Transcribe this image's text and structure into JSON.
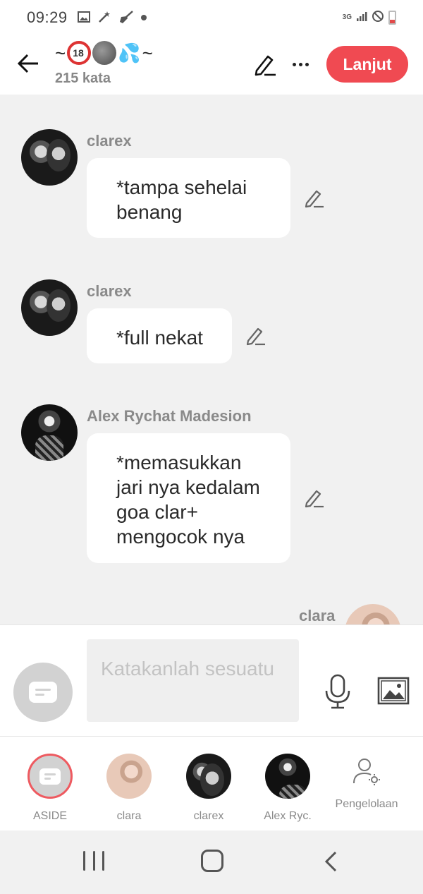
{
  "status_bar": {
    "time": "09:29",
    "network": "3G",
    "icons": [
      "gallery-icon",
      "magic-wand-icon",
      "broom-icon",
      "notification-dot",
      "signal-icon",
      "no-disturb-icon",
      "battery-low-icon"
    ]
  },
  "header": {
    "title_prefix": "~",
    "title_suffix": "~",
    "title_emojis": [
      "no-under-18-emoji",
      "new-moon-face-emoji",
      "sweat-droplets-emoji"
    ],
    "word_count": "215 kata",
    "next_label": "Lanjut",
    "accent_color": "#f04a52"
  },
  "messages": [
    {
      "sender": "clarex",
      "text": "*tampa sehelai benang",
      "avatar": "clarex-avatar"
    },
    {
      "sender": "clarex",
      "text": "*full nekat",
      "avatar": "clarex-avatar"
    },
    {
      "sender": "Alex Rychat Madesion",
      "text": "*memasukkan jari nya kedalam goa clar+ mengocok nya",
      "avatar": "alex-avatar"
    },
    {
      "sender": "clara",
      "text": "",
      "avatar": "clara-avatar"
    }
  ],
  "composer": {
    "placeholder": "Katakanlah sesuatu"
  },
  "participants": [
    {
      "label": "ASIDE"
    },
    {
      "label": "clara"
    },
    {
      "label": "clarex"
    },
    {
      "label": "Alex Ryc."
    },
    {
      "label": "Pengelolaan"
    }
  ]
}
